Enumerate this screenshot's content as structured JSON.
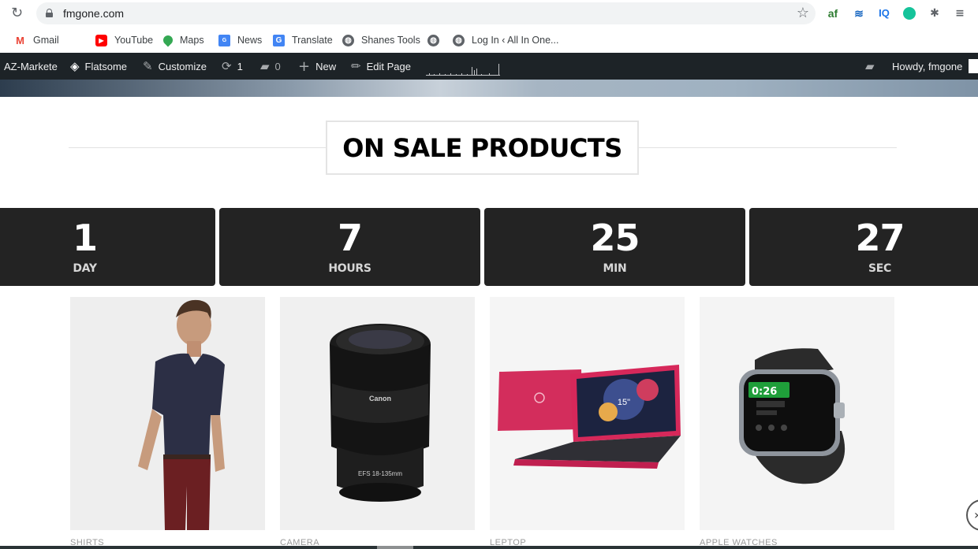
{
  "browser": {
    "url": "fmgone.com",
    "bookmarks": [
      "Gmail",
      "YouTube",
      "Maps",
      "News",
      "Translate",
      "Shanes Tools",
      "Log In ‹ All In One..."
    ]
  },
  "admin_bar": {
    "site": "AZ-Markete",
    "theme": "Flatsome",
    "customize": "Customize",
    "updates_count": "1",
    "comments_count": "0",
    "new": "New",
    "edit_page": "Edit Page",
    "howdy": "Howdy, fmgone"
  },
  "section": {
    "title": "ON SALE PRODUCTS"
  },
  "countdown": [
    {
      "value": "1",
      "label": "DAY"
    },
    {
      "value": "7",
      "label": "HOURS"
    },
    {
      "value": "25",
      "label": "MIN"
    },
    {
      "value": "27",
      "label": "SEC"
    }
  ],
  "products": [
    {
      "category": "SHIRTS",
      "icon": "man-in-tshirt-image"
    },
    {
      "category": "CAMERA",
      "icon": "canon-lens-image",
      "lens_brand": "Canon",
      "lens_model": "EFS 18-135mm"
    },
    {
      "category": "LEPTOP",
      "icon": "pink-laptop-image",
      "screen_size": "15\""
    },
    {
      "category": "APPLE WATCHES",
      "icon": "smartwatch-image",
      "time": "0:26"
    }
  ],
  "colors": {
    "admin_bar": "#1d2327",
    "countdown_bg": "#232323",
    "accent_pink": "#d6285a"
  }
}
